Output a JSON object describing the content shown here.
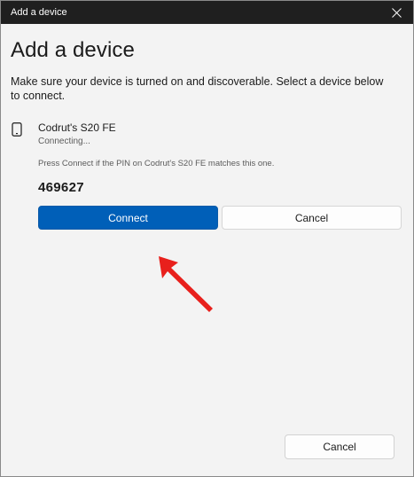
{
  "window": {
    "title": "Add a device",
    "close_icon": "close-icon"
  },
  "dialog": {
    "heading": "Add a device",
    "instructions": "Make sure your device is turned on and discoverable. Select a device below to connect."
  },
  "device": {
    "icon": "phone-icon",
    "name": "Codrut's S20 FE",
    "status": "Connecting...",
    "pin_hint": "Press Connect if the PIN on Codrut's S20 FE matches this one.",
    "pin": "469627"
  },
  "actions": {
    "connect_label": "Connect",
    "cancel_label": "Cancel"
  },
  "footer": {
    "cancel_label": "Cancel"
  },
  "colors": {
    "accent": "#005fb8",
    "titlebar": "#1f1f1f",
    "annotation_arrow": "#e8201c"
  }
}
